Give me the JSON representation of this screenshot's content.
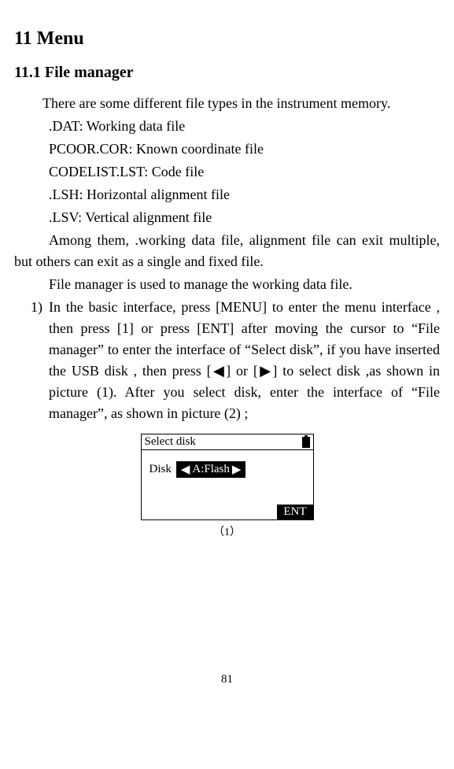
{
  "headings": {
    "h1": "11 Menu",
    "h2": "11.1 File manager"
  },
  "intro": "There are some different file types in the instrument memory.",
  "file_types": [
    ".DAT: Working data file",
    "PCOOR.COR: Known coordinate file",
    "CODELIST.LST: Code file",
    ".LSH: Horizontal alignment file",
    ".LSV: Vertical alignment file"
  ],
  "notes": [
    "Among them, .working data file, alignment file can exit multiple, but others can exit as a single and fixed file.",
    "File manager is used to manage the working data file."
  ],
  "list": {
    "num": "1)",
    "text": "In the basic interface, press [MENU] to enter the menu interface , then press [1] or press [ENT] after moving the cursor to “File manager” to enter the interface of “Select disk”, if you have inserted the USB disk , then press [◀] or [▶] to select disk ,as shown in picture (1). After you select disk, enter the interface of “File manager”, as shown in picture (2) ;"
  },
  "screen": {
    "title": "Select disk",
    "disk_label": "Disk",
    "left_arrow": "◀",
    "value": "A:Flash",
    "right_arrow": "▶",
    "ent": "ENT",
    "caption": "（1）"
  },
  "page_number": "81"
}
